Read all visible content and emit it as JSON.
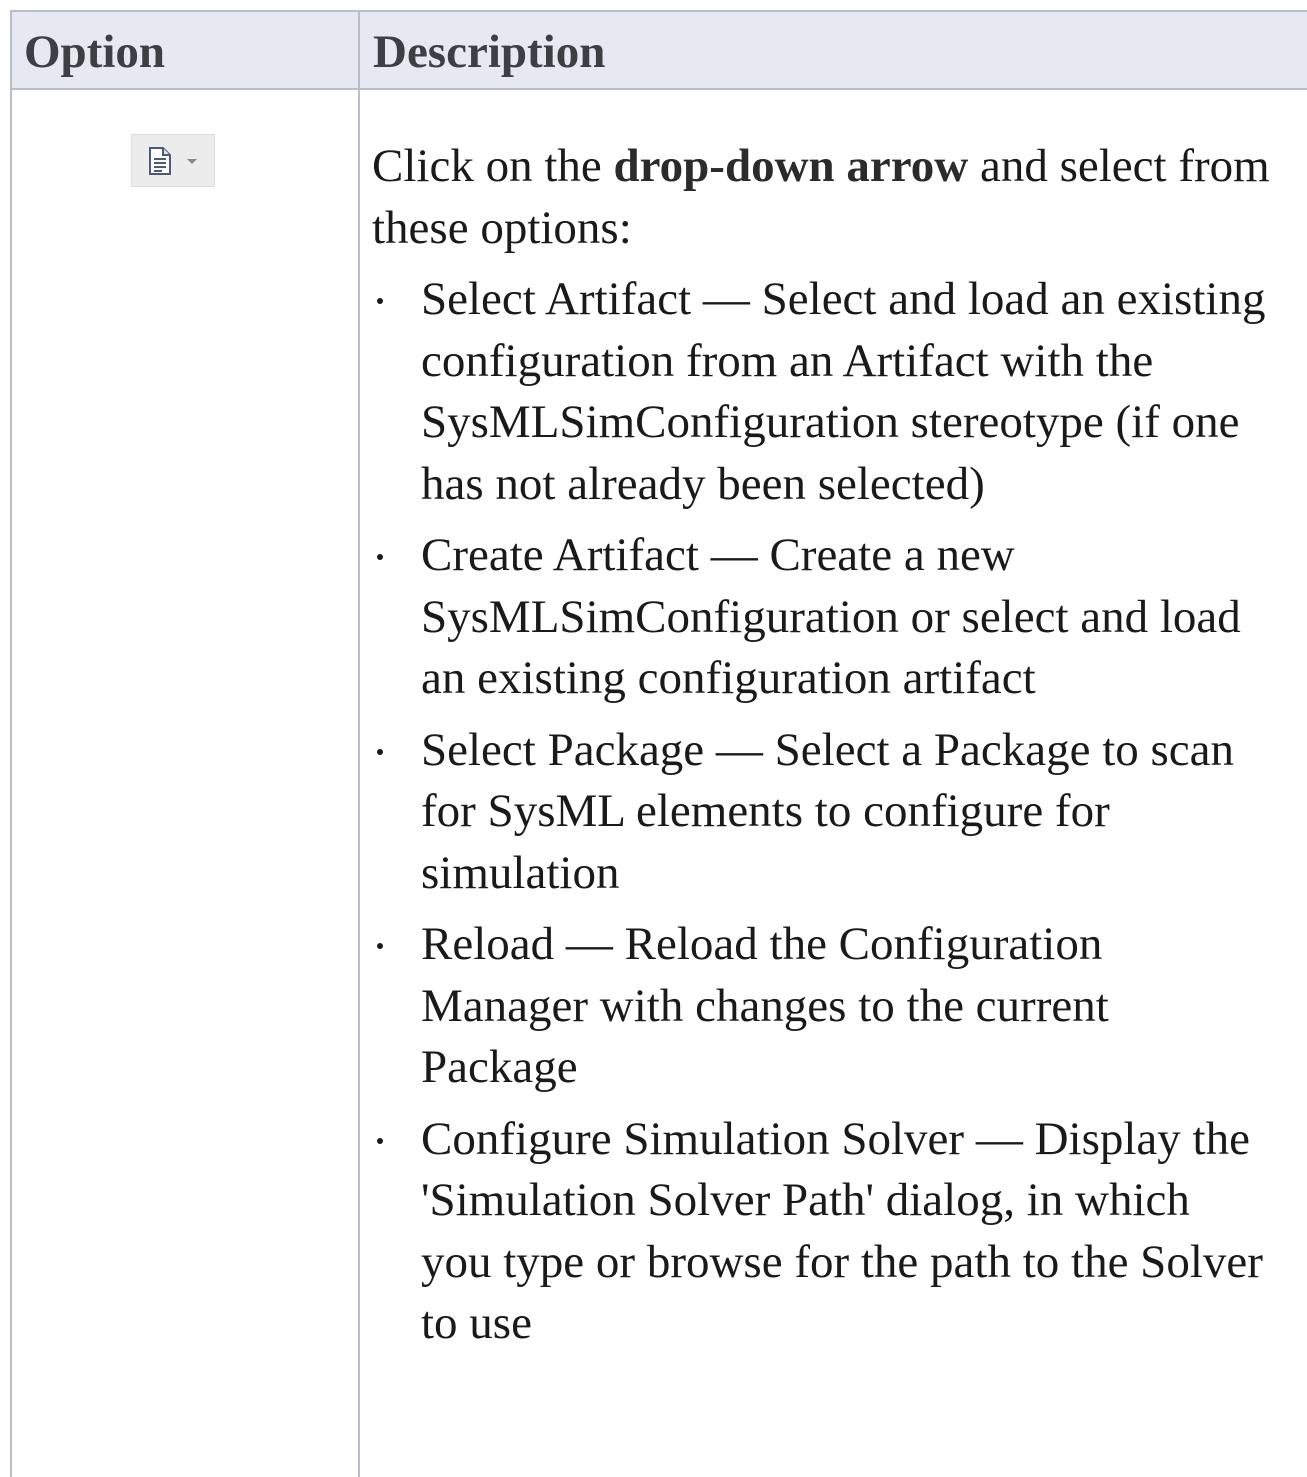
{
  "table": {
    "headers": {
      "option": "Option",
      "description": "Description"
    }
  },
  "row": {
    "option_icon": "document-dropdown-icon",
    "intro_before": "Click on the ",
    "intro_bold": "drop-down arrow",
    "intro_after": " and select from these options:",
    "items": [
      {
        "text": "Select Artifact — Select and load an existing configuration from an Artifact with the SysMLSimConfiguration stereotype (if one has not already been selected)"
      },
      {
        "text": "Create Artifact — Create a new SysMLSimConfiguration or select and load an existing configuration artifact"
      },
      {
        "text": "Select Package — Select a Package to scan for SysML elements to configure for simulation"
      },
      {
        "text": "Reload — Reload the Configuration Manager with changes to the current Package"
      },
      {
        "text": "Configure Simulation Solver — Display the 'Simulation Solver Path' dialog, in which you type or browse for the path to the Solver to use"
      }
    ]
  },
  "colors": {
    "header_bg": "#e6e9f1",
    "border": "#b9bec7",
    "header_text": "#3d3f45"
  }
}
